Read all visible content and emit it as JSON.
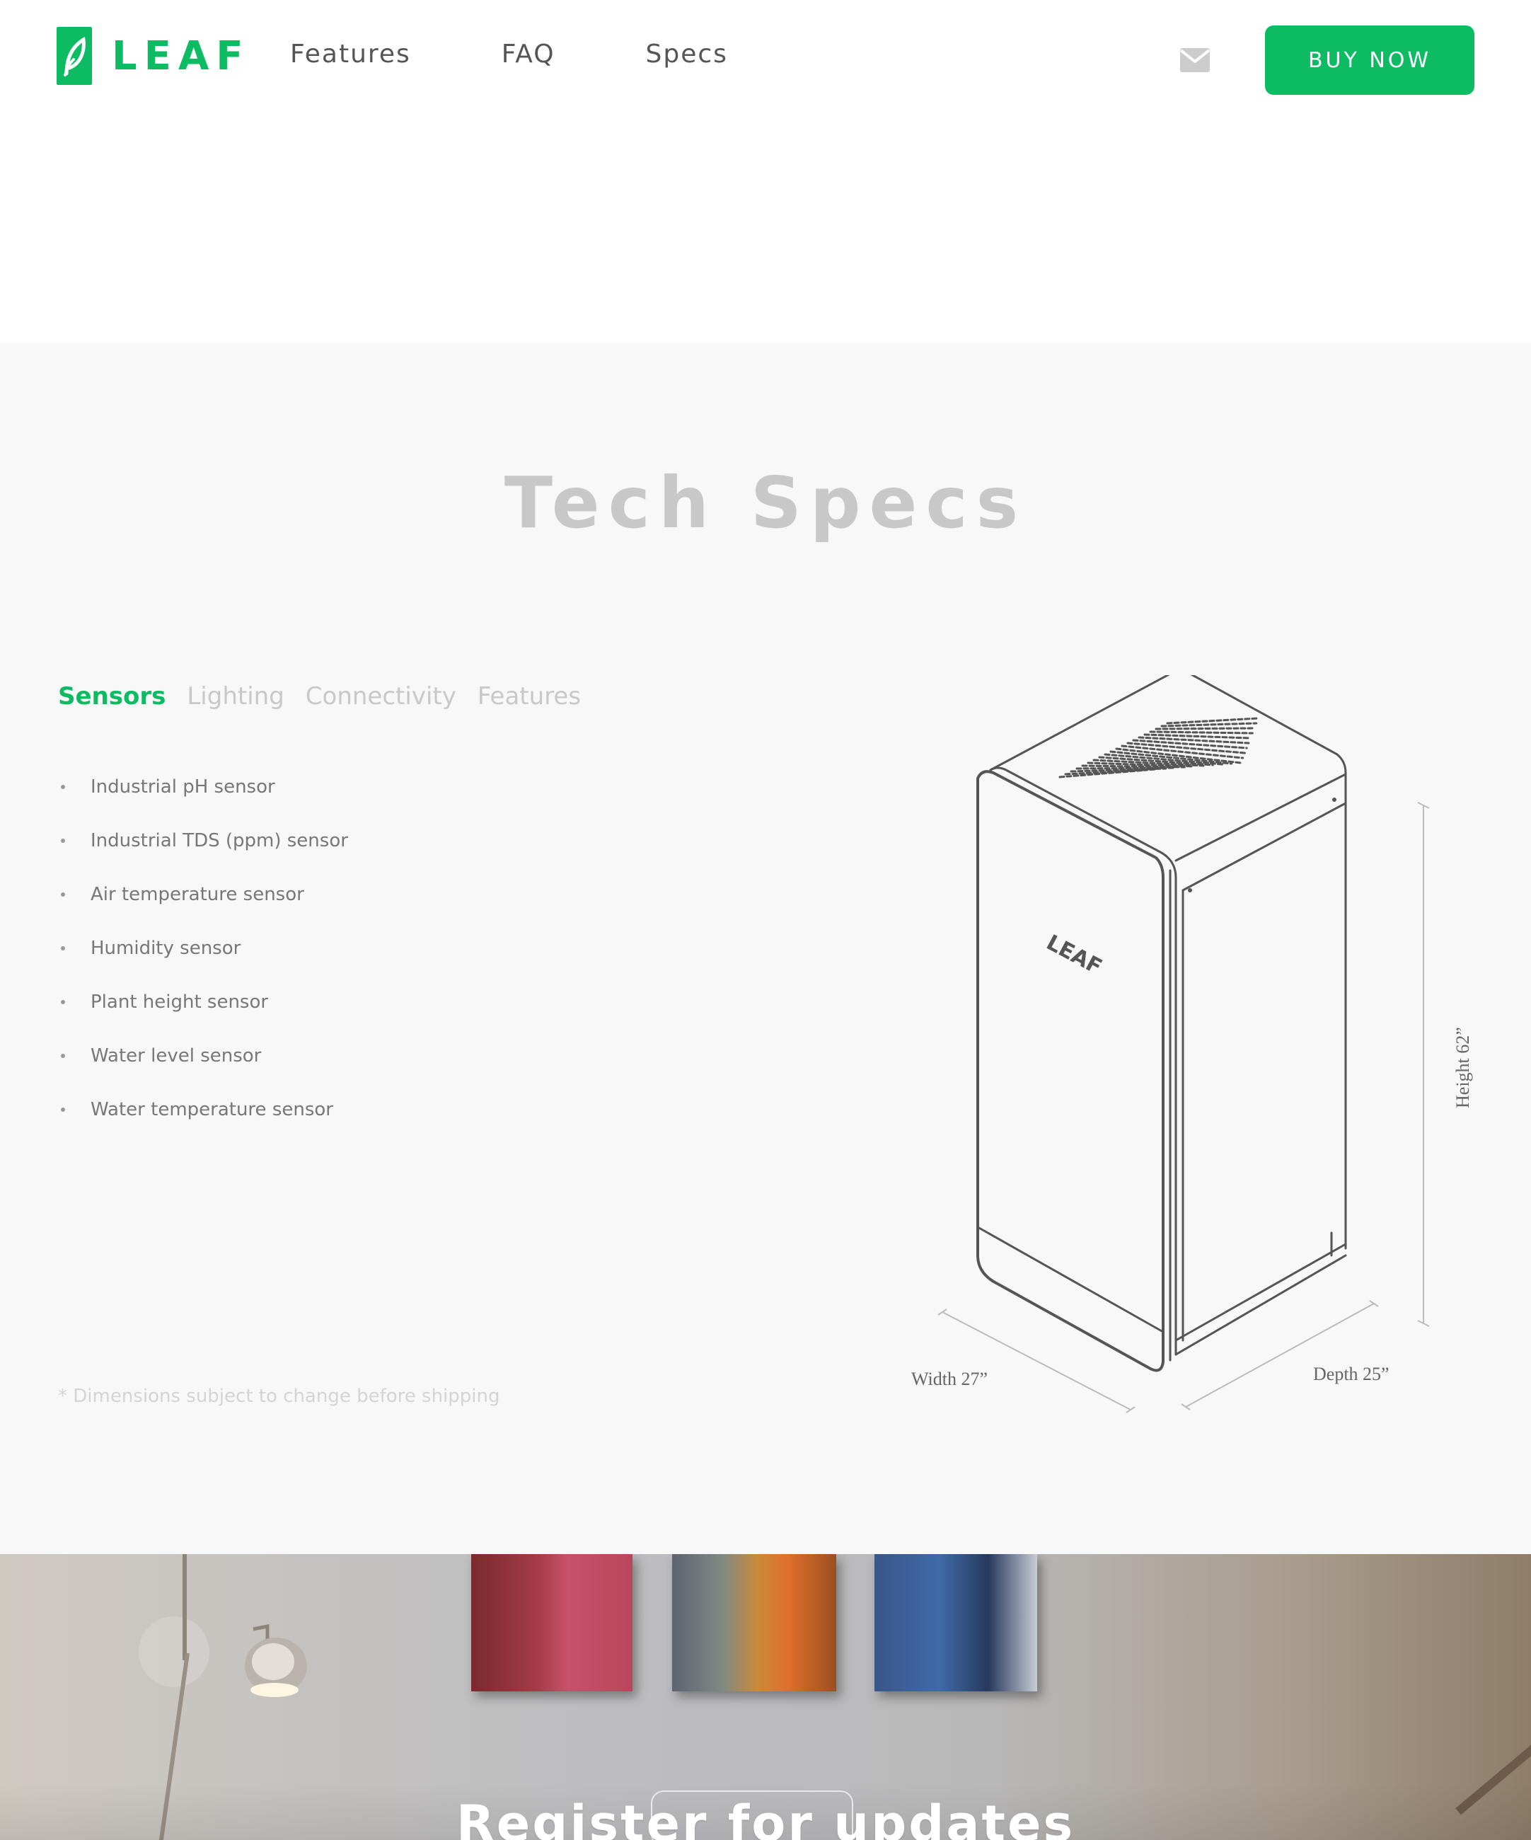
{
  "brand": {
    "name": "LEAF",
    "accent_color": "#0dbb63"
  },
  "nav": {
    "items": [
      {
        "label": "Features"
      },
      {
        "label": "FAQ"
      },
      {
        "label": "Specs"
      }
    ],
    "mail_icon": "envelope-icon",
    "buy_label": "BUY NOW"
  },
  "specs": {
    "title": "Tech Specs",
    "tabs": [
      {
        "label": "Sensors",
        "active": true
      },
      {
        "label": "Lighting",
        "active": false
      },
      {
        "label": "Connectivity",
        "active": false
      },
      {
        "label": "Features",
        "active": false
      }
    ],
    "sensors": [
      "Industrial pH sensor",
      "Industrial TDS (ppm) sensor",
      "Air temperature sensor",
      "Humidity sensor",
      "Plant height sensor",
      "Water level sensor",
      "Water temperature sensor"
    ],
    "footnote": "* Dimensions subject to change before shipping",
    "device": {
      "logo": "LEAF",
      "width_label": "Width 27”",
      "depth_label": "Depth 25”",
      "height_label": "Height 62”"
    }
  },
  "register": {
    "title": "Register for updates"
  }
}
